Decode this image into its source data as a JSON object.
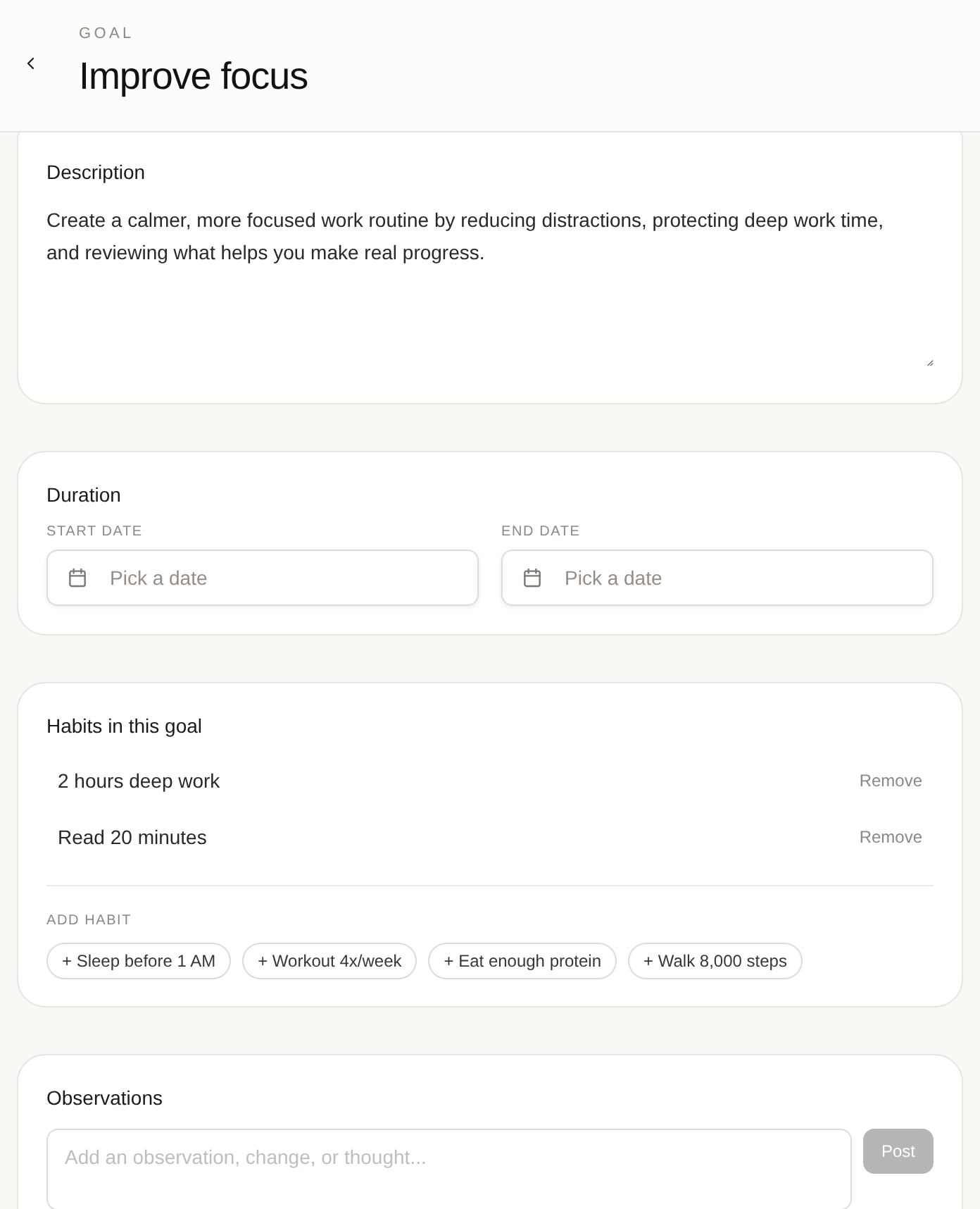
{
  "header": {
    "eyebrow": "GOAL",
    "title": "Improve focus"
  },
  "description": {
    "label": "Description",
    "value": "Create a calmer, more focused work routine by reducing distractions, protecting deep work time, and reviewing what helps you make real progress."
  },
  "duration": {
    "label": "Duration",
    "fields": [
      {
        "label": "START DATE",
        "placeholder": "Pick a date"
      },
      {
        "label": "END DATE",
        "placeholder": "Pick a date"
      }
    ]
  },
  "habits": {
    "label": "Habits in this goal",
    "items": [
      {
        "name": "2 hours deep work",
        "action": "Remove"
      },
      {
        "name": "Read 20 minutes",
        "action": "Remove"
      }
    ],
    "add_label": "ADD HABIT",
    "suggestions": [
      "+ Sleep before 1 AM",
      "+ Workout 4x/week",
      "+ Eat enough protein",
      "+ Walk 8,000 steps"
    ]
  },
  "observations": {
    "label": "Observations",
    "placeholder": "Add an observation, change, or thought...",
    "button": {
      "label": "Post",
      "disabled": true
    }
  }
}
